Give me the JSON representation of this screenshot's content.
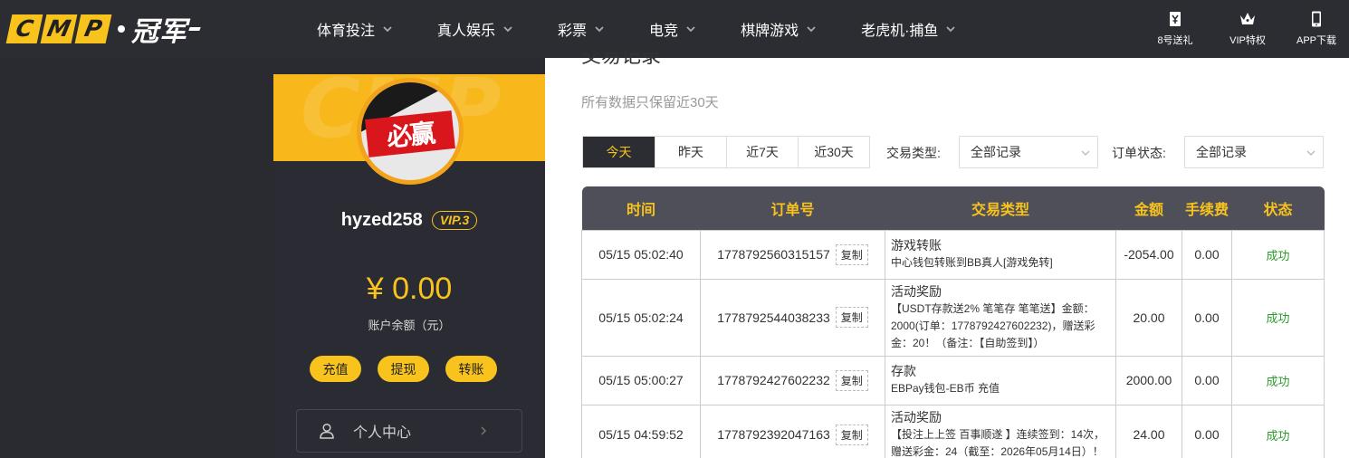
{
  "header": {
    "logo_letters": [
      "C",
      "M",
      "P"
    ],
    "logo_cn": "冠军",
    "nav": [
      {
        "label": "体育投注"
      },
      {
        "label": "真人娱乐"
      },
      {
        "label": "彩票"
      },
      {
        "label": "电竞"
      },
      {
        "label": "棋牌游戏"
      },
      {
        "label": "老虎机·捕鱼"
      }
    ],
    "right": [
      {
        "label": "8号送礼",
        "icon": "gift-ticket-icon"
      },
      {
        "label": "VIP特权",
        "icon": "crown-icon"
      },
      {
        "label": "APP下载",
        "icon": "phone-icon"
      }
    ]
  },
  "sidebar": {
    "avatar_text": "必赢",
    "username": "hyzed258",
    "vip": "VIP.3",
    "balance": "¥ 0.00",
    "balance_label": "账户余额（元）",
    "actions": [
      "充值",
      "提现",
      "转账"
    ],
    "menu_item": "个人中心"
  },
  "main": {
    "title": "交易记录",
    "subtitle": "所有数据只保留近30天",
    "date_tabs": [
      "今天",
      "昨天",
      "近7天",
      "近30天"
    ],
    "active_tab": "今天",
    "filters": {
      "type_label": "交易类型:",
      "type_value": "全部记录",
      "status_label": "订单状态:",
      "status_value": "全部记录"
    },
    "table": {
      "headers": [
        "时间",
        "订单号",
        "交易类型",
        "金额",
        "手续费",
        "状态"
      ],
      "copy_label": "复制",
      "rows": [
        {
          "time": "05/15 05:02:40",
          "order": "1778792560315157",
          "type": "游戏转账",
          "detail": "中心钱包转账到BB真人[游戏免转]",
          "amount": "-2054.00",
          "fee": "0.00",
          "status": "成功"
        },
        {
          "time": "05/15 05:02:24",
          "order": "1778792544038233",
          "type": "活动奖励",
          "detail": "【USDT存款送2% 笔笔存 笔笔送】金额：2000(订单：1778792427602232)，赠送彩金：20！（备注：【自助签到】）",
          "amount": "20.00",
          "fee": "0.00",
          "status": "成功"
        },
        {
          "time": "05/15 05:00:27",
          "order": "1778792427602232",
          "type": "存款",
          "detail": "EBPay钱包-EB币 充值",
          "amount": "2000.00",
          "fee": "0.00",
          "status": "成功"
        },
        {
          "time": "05/15 04:59:52",
          "order": "1778792392047163",
          "type": "活动奖励",
          "detail": "【投注上上签 百事顺遂 】连续签到：14次，赠送彩金：24（截至：2026年05月14日）！",
          "amount": "24.00",
          "fee": "0.00",
          "status": "成功"
        }
      ]
    }
  },
  "colors": {
    "accent": "#f8c31d",
    "dark": "#2c2c33",
    "table_header": "#4f4f59",
    "success": "#2a9c2a"
  }
}
